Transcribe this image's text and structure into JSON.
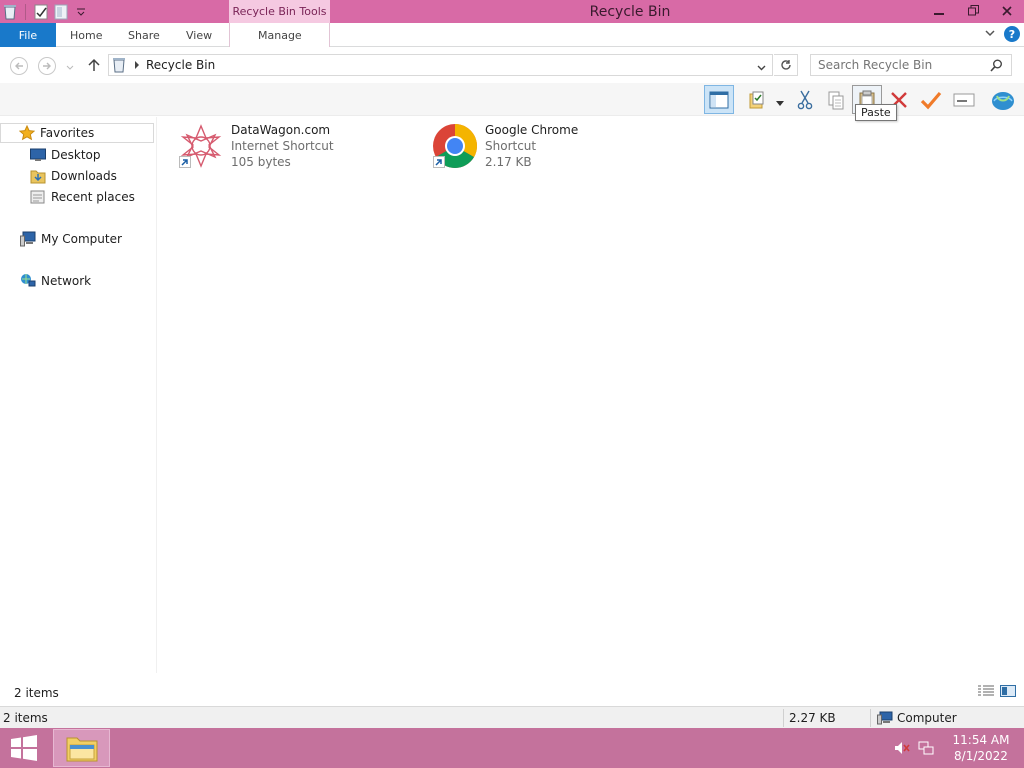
{
  "window": {
    "title": "Recycle Bin",
    "context_tab_group": "Recycle Bin Tools"
  },
  "ribbon": {
    "tabs": [
      {
        "label": "File"
      },
      {
        "label": "Home"
      },
      {
        "label": "Share"
      },
      {
        "label": "View"
      },
      {
        "label": "Manage"
      }
    ]
  },
  "address": {
    "path": "Recycle Bin",
    "search_placeholder": "Search Recycle Bin"
  },
  "toolbar": {
    "tooltip": "Paste",
    "buttons": [
      "preview-pane",
      "properties",
      "cut",
      "copy",
      "paste",
      "delete",
      "select",
      "rename",
      "web"
    ]
  },
  "nav": {
    "favorites": "Favorites",
    "desktop": "Desktop",
    "downloads": "Downloads",
    "recent": "Recent places",
    "computer": "My Computer",
    "network": "Network"
  },
  "files": [
    {
      "name": "DataWagon.com",
      "type": "Internet Shortcut",
      "size": "105 bytes",
      "icon": "datawagon-icon"
    },
    {
      "name": "Google Chrome",
      "type": "Shortcut",
      "size": "2.17 KB",
      "icon": "chrome-icon"
    }
  ],
  "status": {
    "pane_count": "2 items",
    "bar_count": "2 items",
    "bar_size": "2.27 KB",
    "bar_location": "Computer"
  },
  "taskbar": {
    "time": "11:54 AM",
    "date": "8/1/2022"
  },
  "colors": {
    "titlebar": "#d86aa6",
    "file_tab": "#1979ca",
    "taskbar": "#c4729c"
  }
}
